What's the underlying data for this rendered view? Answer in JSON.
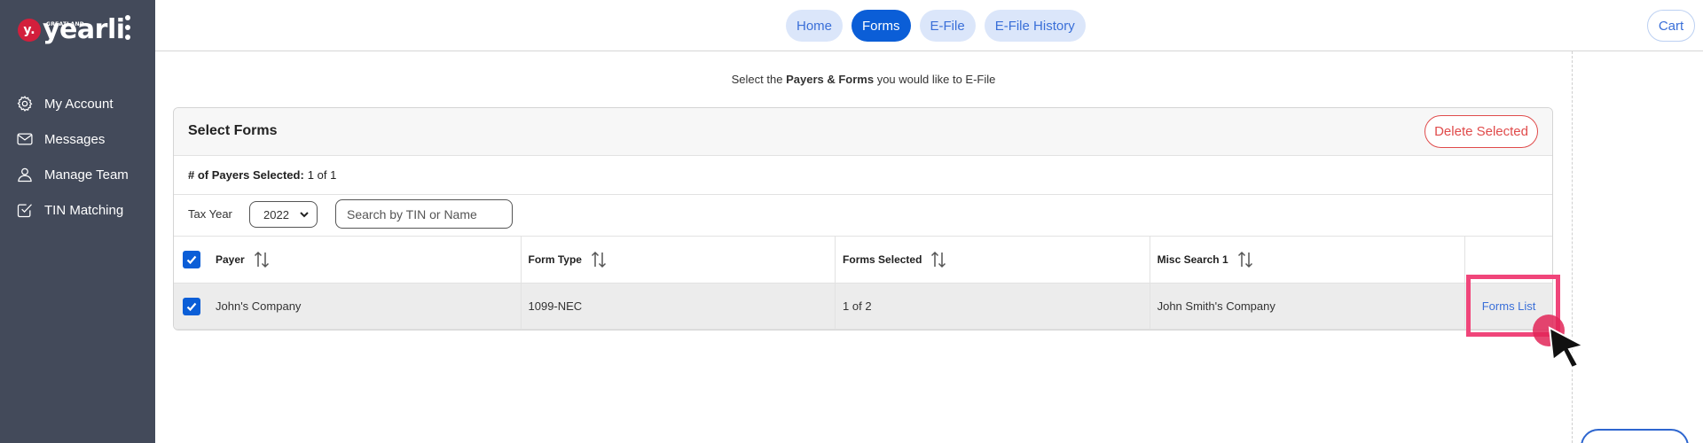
{
  "app": {
    "logo_brand": "yearli",
    "logo_tagline": "GREATLAND",
    "logo_badge": "y."
  },
  "sidebar": {
    "items": [
      {
        "label": "My Account",
        "icon": "gear-icon"
      },
      {
        "label": "Messages",
        "icon": "envelope-icon"
      },
      {
        "label": "Manage Team",
        "icon": "user-icon"
      },
      {
        "label": "TIN Matching",
        "icon": "checkbox-icon"
      }
    ]
  },
  "topnav": {
    "tabs": [
      {
        "label": "Home",
        "active": false
      },
      {
        "label": "Forms",
        "active": true
      },
      {
        "label": "E-File",
        "active": false
      },
      {
        "label": "E-File History",
        "active": false
      }
    ],
    "cart_label": "Cart"
  },
  "instruction": {
    "prefix": "Select the ",
    "bold": "Payers & Forms",
    "suffix": " you would like to E-File"
  },
  "panel": {
    "title": "Select Forms",
    "delete_label": "Delete Selected",
    "payers_selected_label": "# of Payers Selected:",
    "payers_selected_value": "1 of 1",
    "tax_year_label": "Tax Year",
    "tax_year_value": "2022",
    "search_placeholder": "Search by TIN or Name"
  },
  "table": {
    "columns": [
      "Payer",
      "Form Type",
      "Forms Selected",
      "Misc Search 1",
      ""
    ],
    "rows": [
      {
        "payer": "John's Company",
        "form_type": "1099-NEC",
        "forms_selected": "1 of 2",
        "misc_search_1": "John Smith's Company",
        "action": "Forms List",
        "checked": true
      }
    ],
    "header_checked": true
  },
  "colors": {
    "sidebar_bg": "#434a5a",
    "accent": "#0b5ed7",
    "pill_bg": "#dbe6fa",
    "danger": "#e04b4b",
    "highlight": "#f0457a"
  }
}
